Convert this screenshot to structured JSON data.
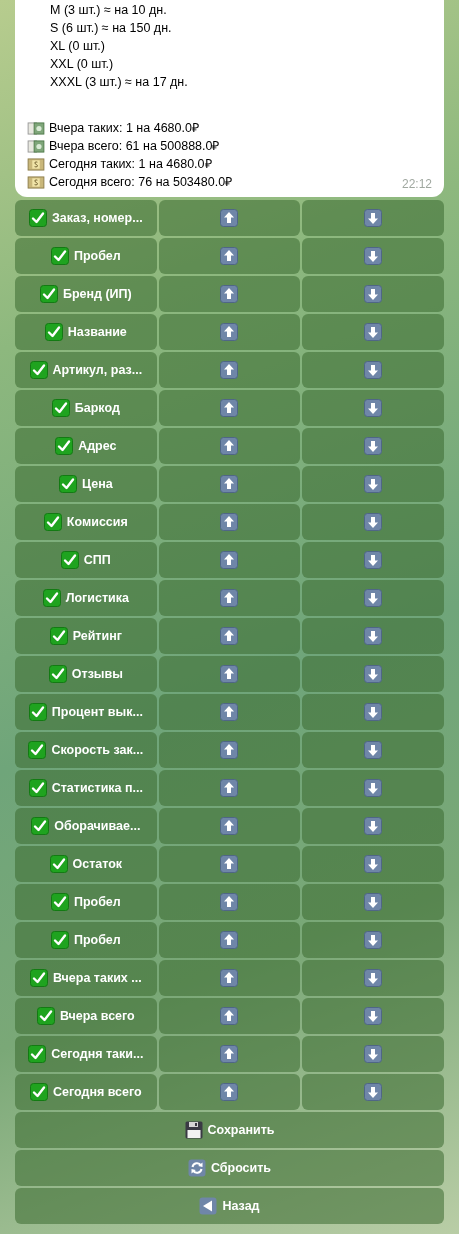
{
  "message": {
    "size_lines": [
      "M (3 шт.) ≈ на 10 дн.",
      "S (6 шт.) ≈ на 150 дн.",
      "XL (0 шт.)",
      "XXL (0 шт.)",
      "XXXL (3 шт.) ≈ на 17 дн."
    ],
    "stats": [
      {
        "kind": "banknote",
        "text": "Вчера таких: 1 на 4680.0₽"
      },
      {
        "kind": "banknote",
        "text": "Вчера всего: 61 на 500888.0₽"
      },
      {
        "kind": "dollar",
        "text": "Сегодня таких: 1 на 4680.0₽"
      },
      {
        "kind": "dollar",
        "text": "Сегодня всего: 76 на 503480.0₽"
      }
    ],
    "time": "22:12"
  },
  "rows": [
    {
      "label": "Заказ, номер...",
      "checked": true
    },
    {
      "label": "Пробел",
      "checked": true
    },
    {
      "label": "Бренд (ИП)",
      "checked": true
    },
    {
      "label": "Название",
      "checked": true
    },
    {
      "label": "Артикул, раз...",
      "checked": true
    },
    {
      "label": "Баркод",
      "checked": true
    },
    {
      "label": "Адрес",
      "checked": true
    },
    {
      "label": "Цена",
      "checked": true
    },
    {
      "label": "Комиссия",
      "checked": true
    },
    {
      "label": "СПП",
      "checked": true
    },
    {
      "label": "Логистика",
      "checked": true
    },
    {
      "label": "Рейтинг",
      "checked": true
    },
    {
      "label": "Отзывы",
      "checked": true
    },
    {
      "label": "Процент вык...",
      "checked": true
    },
    {
      "label": "Скорость зак...",
      "checked": true
    },
    {
      "label": "Статистика п...",
      "checked": true
    },
    {
      "label": "Оборачивае...",
      "checked": true
    },
    {
      "label": "Остаток",
      "checked": true
    },
    {
      "label": "Пробел",
      "checked": true
    },
    {
      "label": "Пробел",
      "checked": true
    },
    {
      "label": "Вчера таких ...",
      "checked": true
    },
    {
      "label": "Вчера всего",
      "checked": true
    },
    {
      "label": "Сегодня таки...",
      "checked": true
    },
    {
      "label": "Сегодня всего",
      "checked": true
    }
  ],
  "actions": [
    {
      "kind": "save",
      "label": "Сохранить"
    },
    {
      "kind": "reset",
      "label": "Сбросить"
    },
    {
      "kind": "back",
      "label": "Назад"
    }
  ]
}
